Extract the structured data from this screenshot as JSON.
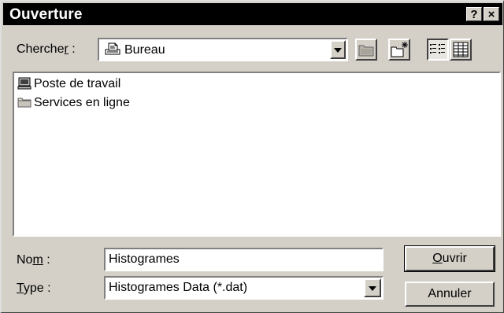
{
  "window": {
    "title": "Ouverture",
    "help_button": "?",
    "close_button": "×"
  },
  "look_in": {
    "label_pre": "Cherche",
    "label_u": "r",
    "label_post": " :",
    "value": "Bureau"
  },
  "toolbar": {
    "up_folder": "up-folder-icon",
    "new_folder": "new-folder-icon",
    "list_view": "list-view-icon",
    "details_view": "details-view-icon"
  },
  "files": [
    {
      "name": "Poste de travail",
      "icon": "computer-icon"
    },
    {
      "name": "Services en ligne",
      "icon": "folder-icon"
    }
  ],
  "filename": {
    "label_pre": "No",
    "label_u": "m",
    "label_post": " :",
    "value": "Histogrames"
  },
  "filetype": {
    "label_u": "T",
    "label_post": "ype :",
    "value": "Histogrames Data (*.dat)"
  },
  "buttons": {
    "open_u": "O",
    "open_rest": "uvrir",
    "cancel": "Annuler"
  }
}
